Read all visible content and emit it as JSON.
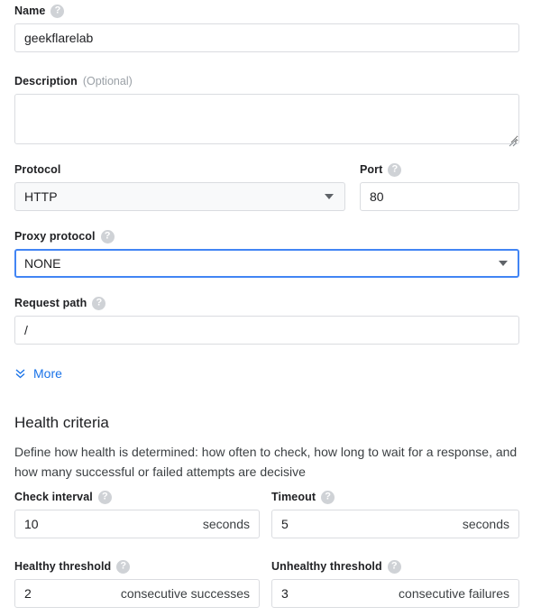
{
  "form": {
    "name": {
      "label": "Name",
      "help_icon": "help-circle-icon",
      "value": "geekflarelab",
      "placeholder": ""
    },
    "description": {
      "label": "Description",
      "optional_tag": "(Optional)",
      "value": "",
      "placeholder": ""
    },
    "protocol": {
      "label": "Protocol",
      "value": "HTTP",
      "caret_icon": "chevron-down-icon"
    },
    "port": {
      "label": "Port",
      "help_icon": "help-circle-icon",
      "value": "80",
      "placeholder": ""
    },
    "proxy_protocol": {
      "label": "Proxy protocol",
      "help_icon": "help-circle-icon",
      "value": "NONE",
      "caret_icon": "chevron-down-icon",
      "focused": true,
      "focus_color": "#4285f4"
    },
    "request_path": {
      "label": "Request path",
      "help_icon": "help-circle-icon",
      "value": "/",
      "placeholder": ""
    },
    "more": {
      "label": "More",
      "icon": "double-chevron-down-icon",
      "color": "#1a73e8"
    }
  },
  "health_criteria": {
    "title": "Health criteria",
    "description": "Define how health is determined: how often to check, how long to wait for a response, and how many successful or failed attempts are decisive",
    "check_interval": {
      "label": "Check interval",
      "help_icon": "help-circle-icon",
      "value": "10",
      "suffix": "seconds"
    },
    "timeout": {
      "label": "Timeout",
      "help_icon": "help-circle-icon",
      "value": "5",
      "suffix": "seconds"
    },
    "healthy_threshold": {
      "label": "Healthy threshold",
      "help_icon": "help-circle-icon",
      "value": "2",
      "suffix": "consecutive successes"
    },
    "unhealthy_threshold": {
      "label": "Unhealthy threshold",
      "help_icon": "help-circle-icon",
      "value": "3",
      "suffix": "consecutive failures"
    }
  },
  "icons": {
    "help_glyph": "?"
  }
}
